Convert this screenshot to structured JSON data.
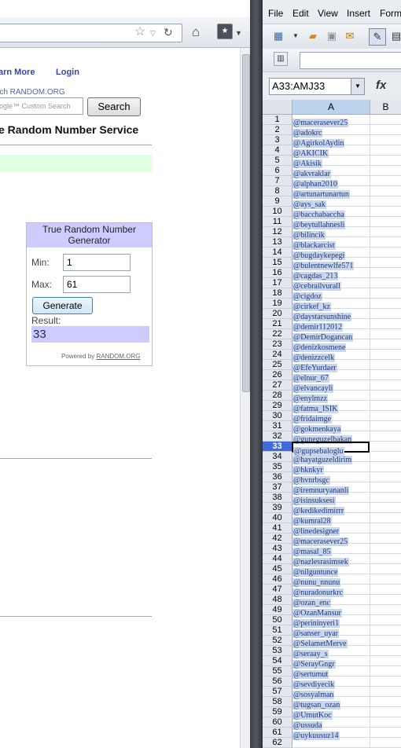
{
  "browser": {
    "nav_links": [
      "arn More",
      "Login"
    ],
    "search_hint": "rch RANDOM.ORG",
    "custom_search_placeholder": "ogle™ Custom Search",
    "search_button": "Search",
    "page_heading": "e Random Number Service",
    "widget": {
      "title": "True Random Number Generator",
      "min_label": "Min:",
      "min_value": "1",
      "max_label": "Max:",
      "max_value": "61",
      "generate_button": "Generate",
      "result_label": "Result:",
      "result_value": "33",
      "powered_by_prefix": "Powered by",
      "powered_by_link": "RANDOM.ORG"
    }
  },
  "spreadsheet": {
    "menu": [
      "File",
      "Edit",
      "View",
      "Insert",
      "Form"
    ],
    "name_box": "A33:AMJ33",
    "fx_label": "fx",
    "columns": [
      "A",
      "B"
    ],
    "active_row": 33,
    "rows": [
      {
        "n": "1",
        "v": "@macerasever25"
      },
      {
        "n": "2",
        "v": "@adokrc"
      },
      {
        "n": "3",
        "v": "@AgirkolAydin"
      },
      {
        "n": "4",
        "v": "@AKICIK"
      },
      {
        "n": "5",
        "v": "@Akisik"
      },
      {
        "n": "6",
        "v": "@akvraklar"
      },
      {
        "n": "7",
        "v": "@alphan2010"
      },
      {
        "n": "8",
        "v": "@artunartunartun"
      },
      {
        "n": "9",
        "v": "@ays_sak"
      },
      {
        "n": "10",
        "v": "@bacchabaccha"
      },
      {
        "n": "11",
        "v": "@beytullahnesli"
      },
      {
        "n": "12",
        "v": "@bilincik"
      },
      {
        "n": "13",
        "v": "@blackarcist"
      },
      {
        "n": "14",
        "v": "@bugdaykepegi"
      },
      {
        "n": "15",
        "v": "@bulentnewlfe571"
      },
      {
        "n": "16",
        "v": "@cagdas_213"
      },
      {
        "n": "17",
        "v": "@cebrailvurall"
      },
      {
        "n": "18",
        "v": "@cigdoz"
      },
      {
        "n": "19",
        "v": "@cirkef_kz"
      },
      {
        "n": "20",
        "v": "@daystarsunshine"
      },
      {
        "n": "21",
        "v": "@demir112012"
      },
      {
        "n": "22",
        "v": "@DemirDogancan"
      },
      {
        "n": "23",
        "v": "@denizkosmene"
      },
      {
        "n": "24",
        "v": "@denizzcelk"
      },
      {
        "n": "25",
        "v": "@EfeYurdaer"
      },
      {
        "n": "26",
        "v": "@elnur_67"
      },
      {
        "n": "27",
        "v": "@elvancayli"
      },
      {
        "n": "28",
        "v": "@enylmzz"
      },
      {
        "n": "29",
        "v": "@fatma_ISIK"
      },
      {
        "n": "30",
        "v": "@fridaimge"
      },
      {
        "n": "31",
        "v": "@gokmenkaya"
      },
      {
        "n": "32",
        "v": "@guneguzelbakan"
      },
      {
        "n": "33",
        "v": "@gupsebaloglu"
      },
      {
        "n": "34",
        "v": "@hayatguzeldirim"
      },
      {
        "n": "35",
        "v": "@hknkyr"
      },
      {
        "n": "36",
        "v": "@hvnrbsgc"
      },
      {
        "n": "37",
        "v": "@iremnuryananli"
      },
      {
        "n": "38",
        "v": "@isinsuksesi"
      },
      {
        "n": "39",
        "v": "@kedikedimirrr"
      },
      {
        "n": "40",
        "v": "@kumral28"
      },
      {
        "n": "41",
        "v": "@linedesigner"
      },
      {
        "n": "42",
        "v": "@macerasever25"
      },
      {
        "n": "43",
        "v": "@masal_85"
      },
      {
        "n": "44",
        "v": "@nazlesrasimsek"
      },
      {
        "n": "45",
        "v": "@nilguntunce"
      },
      {
        "n": "46",
        "v": "@nunu_nnunu"
      },
      {
        "n": "47",
        "v": "@nuradonurkrc"
      },
      {
        "n": "48",
        "v": "@ozan_enc"
      },
      {
        "n": "49",
        "v": "@OzanMansur"
      },
      {
        "n": "50",
        "v": "@perininyeri1"
      },
      {
        "n": "51",
        "v": "@sanser_uyar"
      },
      {
        "n": "52",
        "v": "@SelametMerve"
      },
      {
        "n": "53",
        "v": "@seraay_s"
      },
      {
        "n": "54",
        "v": "@SerayGngr"
      },
      {
        "n": "55",
        "v": "@sertumut"
      },
      {
        "n": "56",
        "v": "@sevdiyecik"
      },
      {
        "n": "57",
        "v": "@sosyalman"
      },
      {
        "n": "58",
        "v": "@tugsan_ozan"
      },
      {
        "n": "59",
        "v": "@UmutKoc"
      },
      {
        "n": "60",
        "v": "@ussuda"
      },
      {
        "n": "61",
        "v": "@uykuusuz14"
      },
      {
        "n": "62",
        "v": ""
      }
    ]
  }
}
